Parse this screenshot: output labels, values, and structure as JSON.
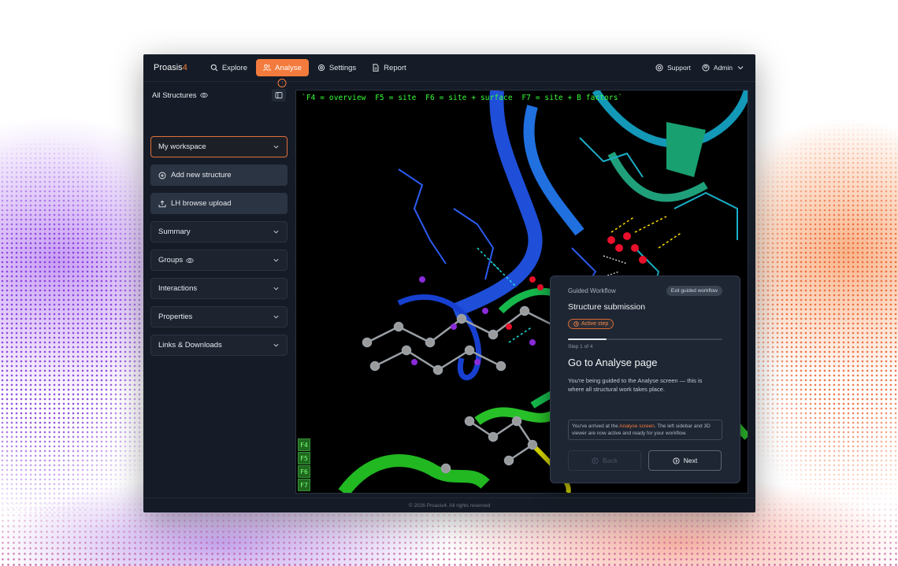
{
  "brand": {
    "name": "Proasis",
    "version": "4"
  },
  "nav": [
    {
      "label": "Explore",
      "icon": "search-icon"
    },
    {
      "label": "Analyse",
      "icon": "users-icon",
      "active": true
    },
    {
      "label": "Settings",
      "icon": "gear-icon"
    },
    {
      "label": "Report",
      "icon": "document-icon"
    }
  ],
  "topbar_right": {
    "support": "Support",
    "user": "Admin"
  },
  "sidebar": {
    "title": "All Structures",
    "workspace_select": "My workspace",
    "add_structure": "Add new structure",
    "upload": "LH browse upload",
    "sections": [
      "Summary",
      "Groups",
      "Interactions",
      "Properties",
      "Links & Downloads"
    ]
  },
  "viewer": {
    "command_line": "`F4 = overview  F5 = site  F6 = site + surface  F7 = site + B factors`",
    "fkeys": [
      "F4",
      "F5",
      "F6",
      "F7"
    ]
  },
  "guide": {
    "kicker": "Guided Workflow",
    "exit": "Exit guided workflow",
    "title": "Structure submission",
    "badge": "Active step",
    "step": "Step 1 of 4",
    "progress_fraction": 0.25,
    "heading": "Go to Analyse page",
    "body": "You're being guided to the Analyse screen — this is where all structural work takes place.",
    "note_prefix": "You've arrived at the ",
    "note_highlight": "Analyse screen",
    "note_suffix": ". The left sidebar and 3D viewer are now active and ready for your workflow.",
    "back": "Back",
    "next": "Next"
  },
  "footer": "© 2026 Proasis4. All rights reserved",
  "colors": {
    "accent": "#f27b3d",
    "panel": "#161c27",
    "terminal_green": "#37ff37"
  }
}
